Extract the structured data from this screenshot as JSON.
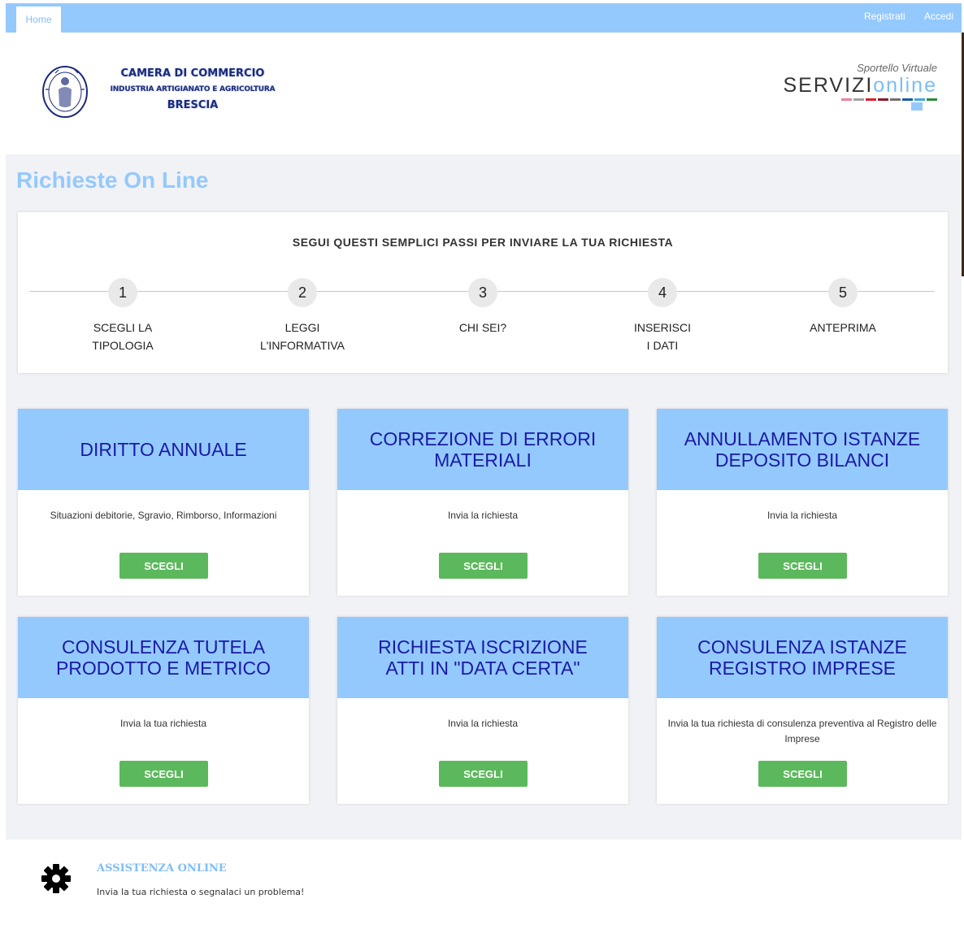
{
  "topbar": {
    "home": "Home",
    "register": "Registrati",
    "login": "Accedi"
  },
  "header": {
    "org_line1": "CAMERA DI COMMERCIO",
    "org_line2": "INDUSTRIA ARTIGIANATO E AGRICOLTURA",
    "org_line3": "BRESCIA",
    "seal_icon": "chamber-seal-icon",
    "service_sub": "Sportello Virtuale",
    "service_main_a": "SERVIZI",
    "service_main_b": "online",
    "service_bar_colors": [
      "#e8849a",
      "#a0a0a0",
      "#d62030",
      "#8a1a2a",
      "#707070",
      "#1a5aaa",
      "#3fa7e0",
      "#2e8b3a"
    ]
  },
  "page_title": "Richieste On Line",
  "steps": {
    "title": "SEGUI QUESTI SEMPLICI PASSI PER INVIARE LA TUA RICHIESTA",
    "items": [
      {
        "num": "1",
        "line1": "SCEGLI LA",
        "line2": "TIPOLOGIA"
      },
      {
        "num": "2",
        "line1": "LEGGI",
        "line2": "L'INFORMATIVA"
      },
      {
        "num": "3",
        "line1": "CHI SEI?",
        "line2": ""
      },
      {
        "num": "4",
        "line1": "INSERISCI",
        "line2": "I DATI"
      },
      {
        "num": "5",
        "line1": "ANTEPRIMA",
        "line2": ""
      }
    ]
  },
  "cards": [
    {
      "line1": "DIRITTO ANNUALE",
      "line2": "",
      "desc": "Situazioni debitorie, Sgravio, Rimborso, Informazioni",
      "button": "SCEGLI"
    },
    {
      "line1": "CORREZIONE DI ERRORI",
      "line2": "MATERIALI",
      "desc": "Invia la richiesta",
      "button": "SCEGLI"
    },
    {
      "line1": "ANNULLAMENTO ISTANZE",
      "line2": "DEPOSITO BILANCI",
      "desc": "Invia la richiesta",
      "button": "SCEGLI"
    },
    {
      "line1": "CONSULENZA TUTELA",
      "line2": "PRODOTTO E METRICO",
      "desc": "Invia la tua richiesta",
      "button": "SCEGLI"
    },
    {
      "line1": "RICHIESTA ISCRIZIONE",
      "line2": "ATTI IN \"DATA CERTA\"",
      "desc": "Invia la richiesta",
      "button": "SCEGLI"
    },
    {
      "line1": "CONSULENZA ISTANZE",
      "line2": "REGISTRO IMPRESE",
      "desc": "Invia la tua richiesta di consulenza preventiva al Registro delle Imprese",
      "button": "SCEGLI"
    }
  ],
  "assist": {
    "icon": "gear-icon",
    "title": "ASSISTENZA ONLINE",
    "subtitle": "Invia la tua richiesta o segnalaci un problema!"
  },
  "colors": {
    "accent_light_blue": "#94c9fd",
    "card_title": "#1a1aa6",
    "button_green": "#5cb85c",
    "page_bg": "#f1f2f6"
  }
}
